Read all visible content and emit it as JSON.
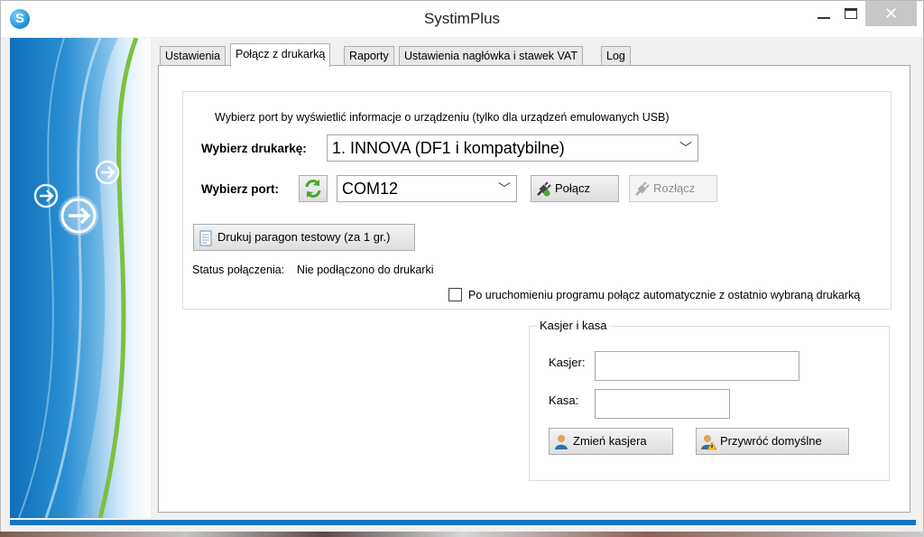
{
  "window": {
    "title": "SystimPlus",
    "app_icon_letter": "S"
  },
  "tabs": [
    {
      "label": "Ustawienia",
      "active": false
    },
    {
      "label": "Połącz z drukarką",
      "active": true
    },
    {
      "label": "Raporty",
      "active": false
    },
    {
      "label": "Ustawienia nagłówka i stawek VAT",
      "active": false
    },
    {
      "label": "Log",
      "active": false
    }
  ],
  "connect": {
    "info_text": "Wybierz port by wyświetlić informacje o urządzeniu (tylko dla urządzeń emulowanych USB)",
    "printer_label": "Wybierz drukarkę:",
    "printer_value": "1. INNOVA (DF1 i kompatybilne)",
    "port_label": "Wybierz port:",
    "port_value": "COM12",
    "connect_button": "Połącz",
    "disconnect_button": "Rozłącz",
    "test_print_button": "Drukuj paragon testowy (za 1 gr.)",
    "status_label": "Status połączenia:",
    "status_value": "Nie podłączono do drukarki",
    "auto_connect_label": "Po uruchomieniu programu połącz automatycznie z ostatnio wybraną drukarką",
    "auto_connect_checked": false
  },
  "cashier_group": {
    "legend": "Kasjer i kasa",
    "cashier_label": "Kasjer:",
    "cashier_value": "",
    "register_label": "Kasa:",
    "register_value": "",
    "change_cashier_button": "Zmień kasjera",
    "restore_defaults_button": "Przywróć domyślne"
  },
  "icons": {
    "app": "systim-logo-icon",
    "refresh": "refresh-icon",
    "connect": "plug-icon",
    "disconnect": "unplug-icon",
    "test_print": "receipt-icon",
    "change_cashier": "user-icon",
    "restore_defaults": "user-warning-icon"
  },
  "colors": {
    "accent": "#1676c0",
    "sidebar_green": "#7cc142"
  }
}
